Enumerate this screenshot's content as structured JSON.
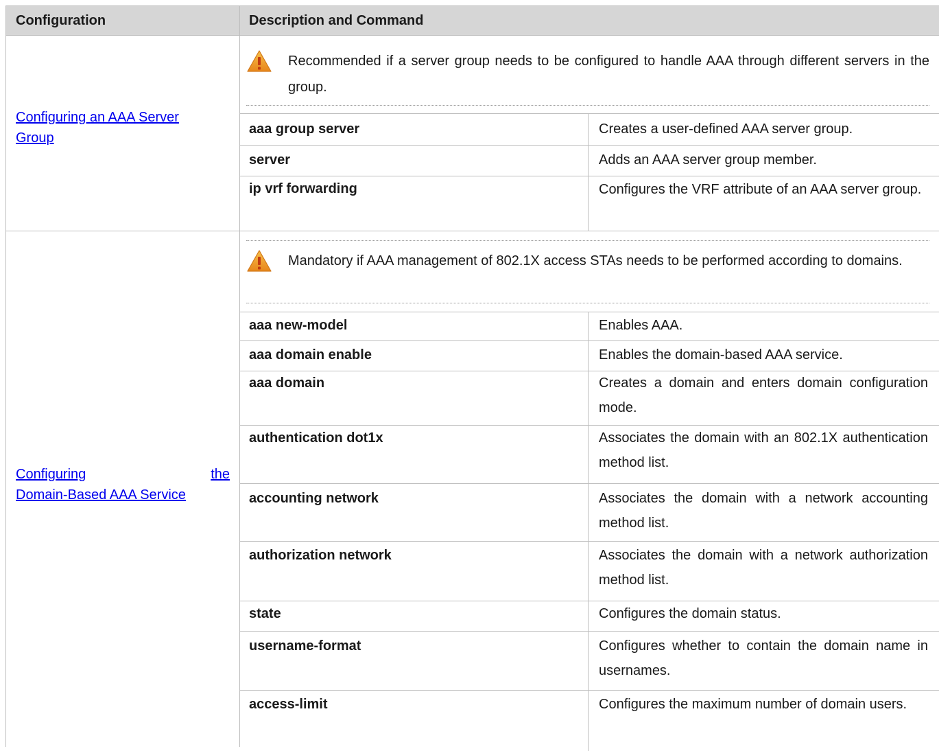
{
  "table": {
    "headers": {
      "configuration": "Configuration",
      "description": "Description and Command"
    },
    "sections": [
      {
        "config_link_lines": [
          "Configuring an AAA Server",
          "Group"
        ],
        "note": "Recommended if a server group needs to be configured to handle AAA through different servers in the group.",
        "rows": [
          {
            "command": "aaa group server",
            "description": "Creates a user-defined AAA server group."
          },
          {
            "command": "server",
            "description": "Adds an AAA server group member."
          },
          {
            "command": "ip vrf forwarding",
            "description": "Configures the VRF attribute of an AAA server group."
          }
        ]
      },
      {
        "config_link_lines": [
          "Configuring the",
          "Domain-Based AAA Service"
        ],
        "note": "Mandatory if AAA management of 802.1X access STAs needs to be performed according to domains.",
        "rows": [
          {
            "command": "aaa new-model",
            "description": "Enables AAA."
          },
          {
            "command": "aaa domain enable",
            "description": "Enables the domain-based AAA service."
          },
          {
            "command": "aaa domain",
            "description": "Creates a domain and enters domain configuration mode."
          },
          {
            "command": "authentication dot1x",
            "description": "Associates the domain with an 802.1X authentication method list."
          },
          {
            "command": "accounting network",
            "description": "Associates the domain with a network accounting method list."
          },
          {
            "command": "authorization network",
            "description": "Associates the domain with a network authorization method list."
          },
          {
            "command": "state",
            "description": "Configures the domain status."
          },
          {
            "command": "username-format",
            "description": "Configures whether to contain the domain name in usernames."
          },
          {
            "command": "access-limit",
            "description": "Configures the maximum number of domain users."
          }
        ]
      }
    ]
  },
  "colors": {
    "header_bg": "#d6d6d6",
    "border": "#bdbdbd",
    "link": "#0000ee",
    "caution_icon": "#f0a020"
  },
  "icons": {
    "note": "caution-triangle-icon"
  }
}
